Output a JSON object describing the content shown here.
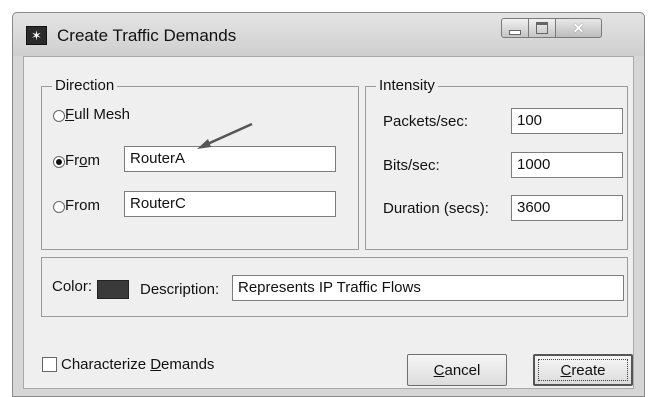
{
  "window": {
    "title": "Create Traffic Demands",
    "icon": "star-icon"
  },
  "direction": {
    "legend": "Direction",
    "full_mesh": {
      "prefix": "",
      "accel": "F",
      "suffix": "ull Mesh",
      "selected": false
    },
    "from1": {
      "prefix": "Fr",
      "accel": "o",
      "suffix": "m",
      "value": "RouterA",
      "selected": true
    },
    "from2": {
      "label": "From",
      "value": "RouterC",
      "selected": false
    }
  },
  "intensity": {
    "legend": "Intensity",
    "packets_label": "Packets/sec:",
    "packets_value": "100",
    "bits_label": "Bits/sec:",
    "bits_value": "1000",
    "duration_label": "Duration (secs):",
    "duration_value": "3600"
  },
  "appearance": {
    "color_label": "Color:",
    "color_value": "#3a3a3a",
    "description_label": "Description:",
    "description_value": "Represents IP Traffic Flows"
  },
  "footer": {
    "characterize_accel": "D",
    "characterize_prefix": "Characterize ",
    "characterize_suffix": "emands",
    "characterize_checked": false,
    "cancel_accel": "C",
    "cancel_suffix": "ancel",
    "create_accel": "C",
    "create_suffix": "reate"
  }
}
